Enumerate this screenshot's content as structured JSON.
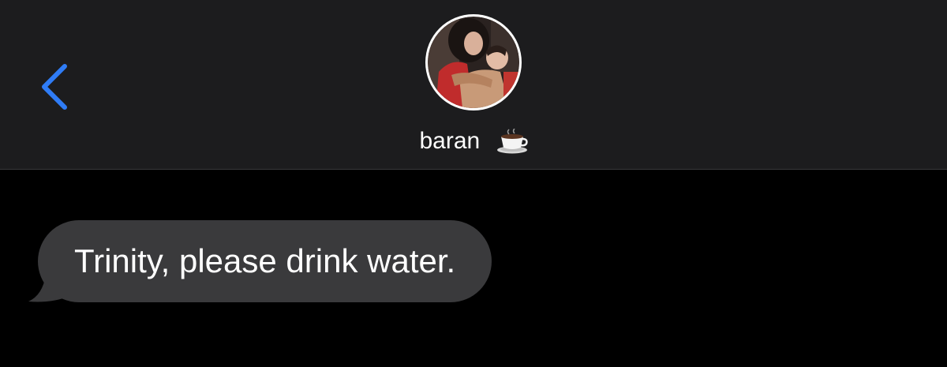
{
  "nav": {
    "back_icon": "chevron-left-icon",
    "accent_color": "#2f7cf6"
  },
  "contact": {
    "name": "baran",
    "status_icon": "coffee-cup-icon"
  },
  "messages": [
    {
      "direction": "incoming",
      "text": "Trinity, please drink water."
    }
  ],
  "colors": {
    "nav_background": "#1c1c1e",
    "conversation_background": "#000000",
    "incoming_bubble": "#3a3a3c",
    "text": "#ffffff"
  }
}
